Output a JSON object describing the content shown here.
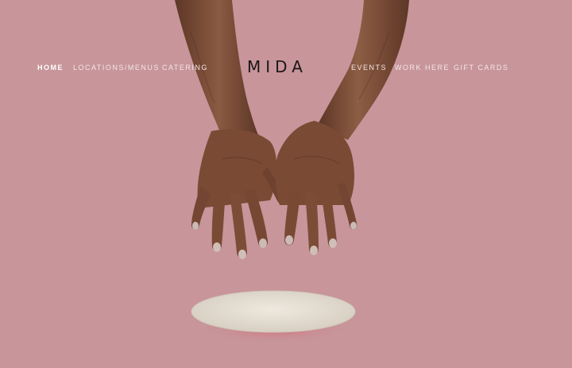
{
  "nav": {
    "left_items": [
      {
        "label": "HOME",
        "active": true
      },
      {
        "label": "LOCATIONS/MENUS",
        "active": false
      },
      {
        "label": "CATERING",
        "active": false
      }
    ],
    "logo": "MIDA",
    "right_items": [
      {
        "label": "EVENTS",
        "active": false
      },
      {
        "label": "WORK HERE",
        "active": false
      },
      {
        "label": "GIFT CARDS",
        "active": false
      }
    ]
  },
  "colors": {
    "background": "#c7959a",
    "nav_text": "#f3e7e8",
    "logo": "#1e1618",
    "skin": "#7a4b35",
    "plate": "#e4ddd2"
  }
}
